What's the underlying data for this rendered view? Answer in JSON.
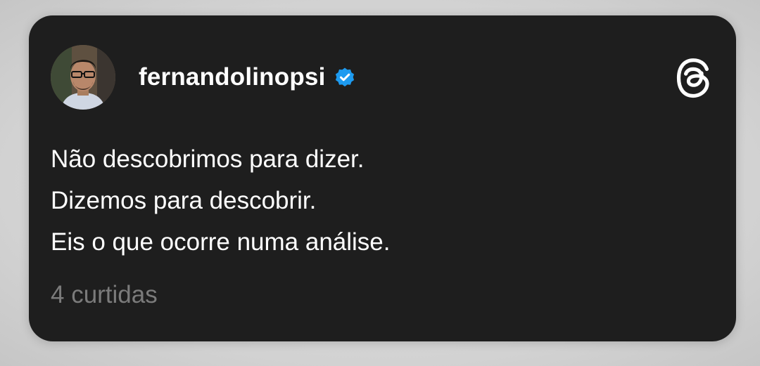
{
  "post": {
    "username": "fernandolinopsi",
    "verified": true,
    "lines": [
      "Não descobrimos para dizer.",
      "Dizemos para descobrir.",
      "Eis o que ocorre numa análise."
    ],
    "likes_label": "4 curtidas"
  },
  "icons": {
    "verified": "verified-badge-icon",
    "logo": "threads-logo-icon",
    "avatar": "profile-photo"
  },
  "colors": {
    "card_background": "#1e1e1e",
    "text_primary": "#ffffff",
    "text_secondary": "#7b7b7b",
    "verified_blue": "#1d9bf0"
  }
}
